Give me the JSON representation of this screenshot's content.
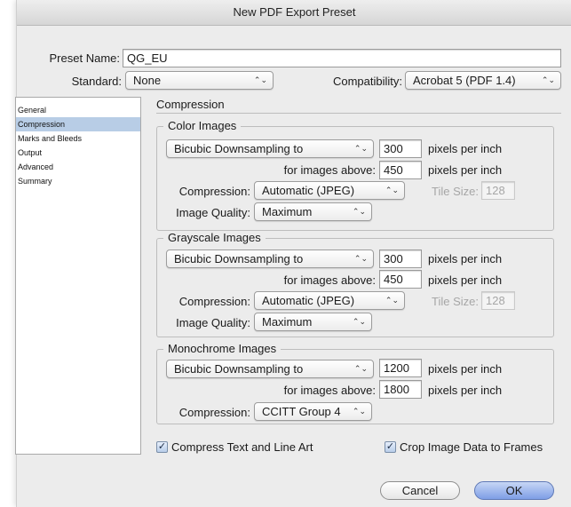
{
  "window": {
    "title": "New PDF Export Preset"
  },
  "preset": {
    "label": "Preset Name:",
    "value": "QG_EU"
  },
  "standard": {
    "label": "Standard:",
    "value": "None"
  },
  "compatibility": {
    "label": "Compatibility:",
    "value": "Acrobat 5 (PDF 1.4)"
  },
  "sidebar": {
    "items": [
      {
        "label": "General"
      },
      {
        "label": "Compression",
        "selected": true
      },
      {
        "label": "Marks and Bleeds"
      },
      {
        "label": "Output"
      },
      {
        "label": "Advanced"
      },
      {
        "label": "Summary"
      }
    ]
  },
  "panel": {
    "title": "Compression"
  },
  "color": {
    "title": "Color Images",
    "downsample": "Bicubic Downsampling to",
    "ppi": "300",
    "ppi_unit": "pixels per inch",
    "above_label": "for images above:",
    "above": "450",
    "above_unit": "pixels per inch",
    "compression_label": "Compression:",
    "compression": "Automatic (JPEG)",
    "tile_label": "Tile Size:",
    "tile": "128",
    "quality_label": "Image Quality:",
    "quality": "Maximum"
  },
  "gray": {
    "title": "Grayscale Images",
    "downsample": "Bicubic Downsampling to",
    "ppi": "300",
    "ppi_unit": "pixels per inch",
    "above_label": "for images above:",
    "above": "450",
    "above_unit": "pixels per inch",
    "compression_label": "Compression:",
    "compression": "Automatic (JPEG)",
    "tile_label": "Tile Size:",
    "tile": "128",
    "quality_label": "Image Quality:",
    "quality": "Maximum"
  },
  "mono": {
    "title": "Monochrome Images",
    "downsample": "Bicubic Downsampling to",
    "ppi": "1200",
    "ppi_unit": "pixels per inch",
    "above_label": "for images above:",
    "above": "1800",
    "above_unit": "pixels per inch",
    "compression_label": "Compression:",
    "compression": "CCITT Group 4"
  },
  "options": {
    "compress_text": {
      "label": "Compress Text and Line Art",
      "checked": true
    },
    "crop_image": {
      "label": "Crop Image Data to Frames",
      "checked": true
    }
  },
  "buttons": {
    "cancel": "Cancel",
    "ok": "OK"
  },
  "icons": {
    "popup_arrows": "⌃⌄",
    "check": "✓"
  }
}
